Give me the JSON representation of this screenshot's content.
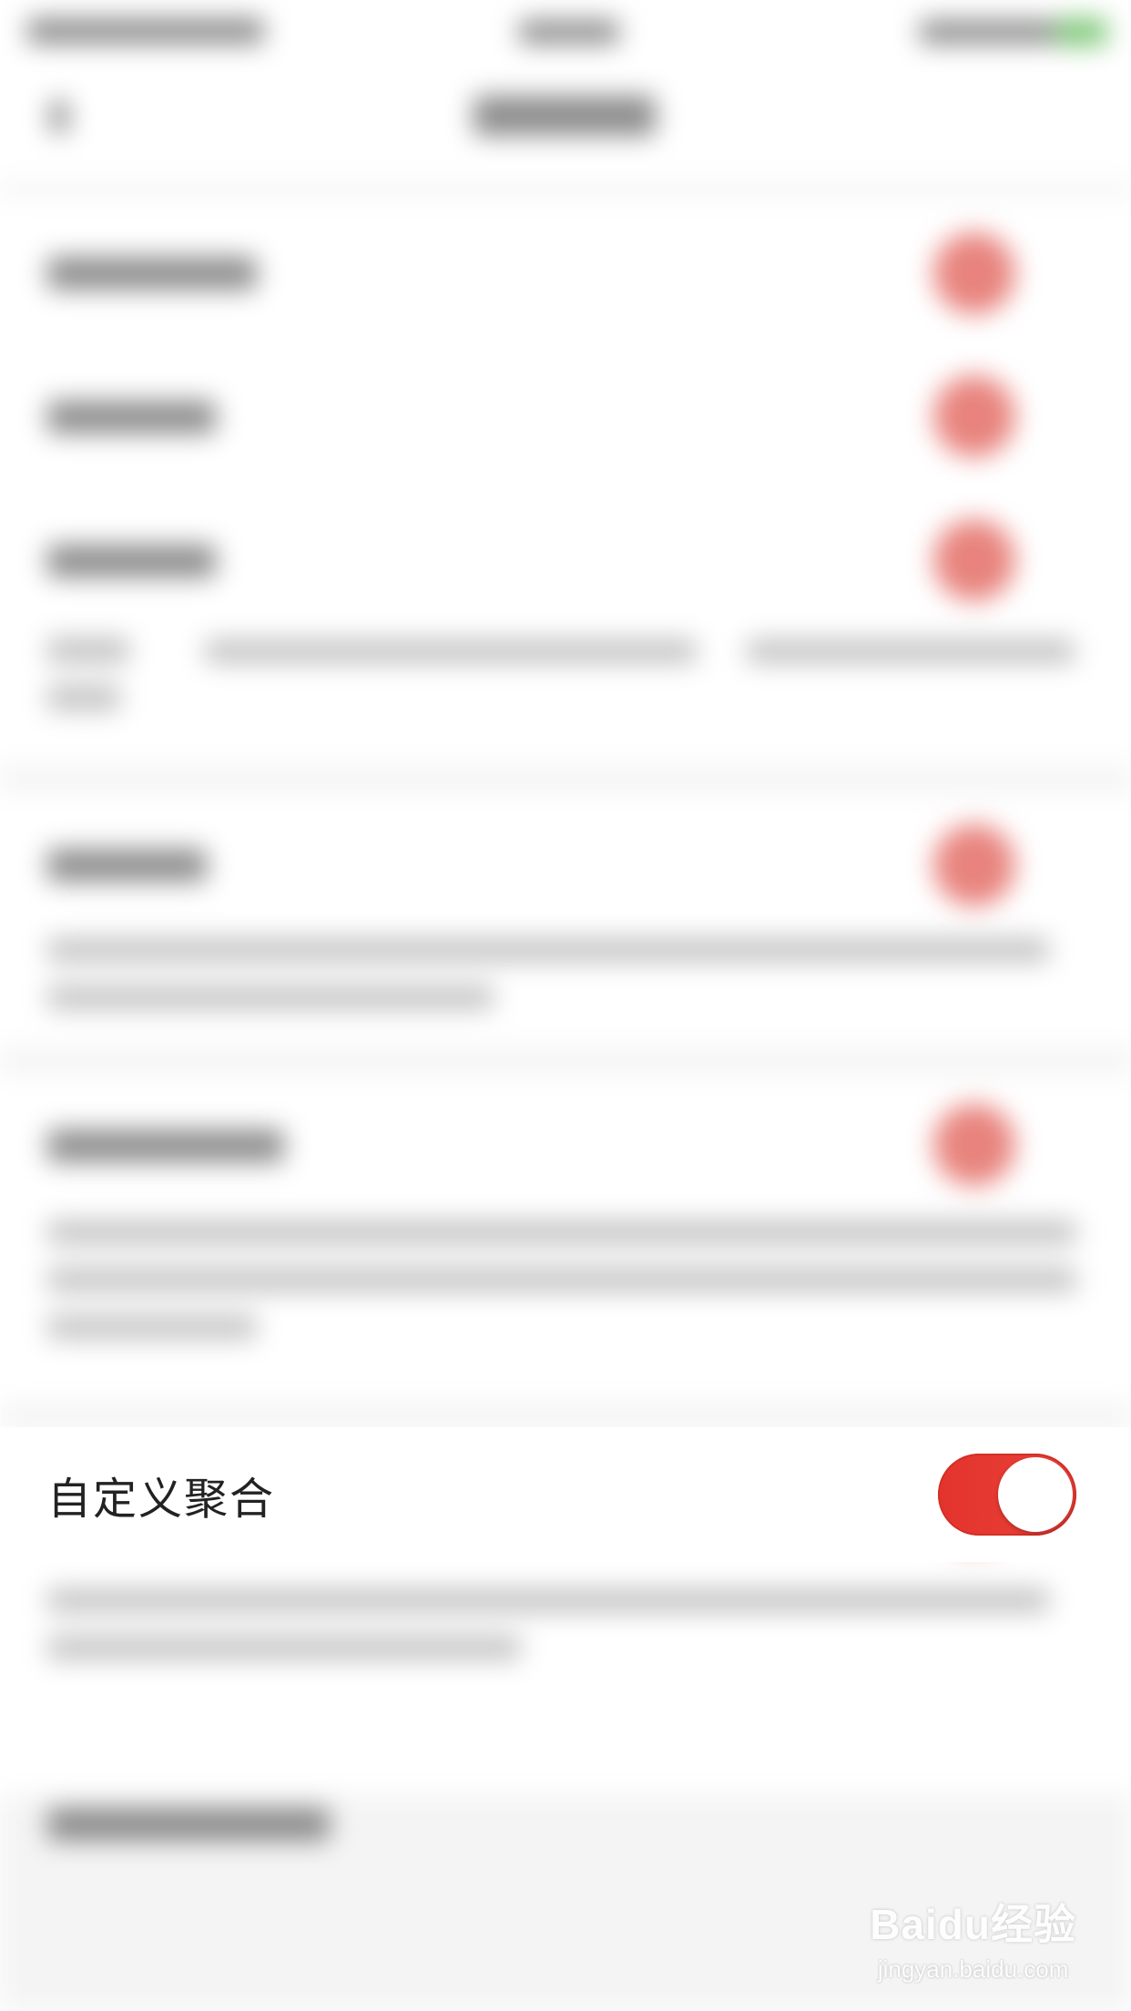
{
  "setting": {
    "label": "自定义聚合",
    "toggle_on": true
  },
  "watermark": {
    "logo_text": "Baidu经验",
    "url": "jingyan.baidu.com"
  },
  "colors": {
    "accent": "#e53a32",
    "toggle_on": "#e53a32",
    "background": "#f4f4f4",
    "row": "#ffffff",
    "text": "#222222"
  }
}
